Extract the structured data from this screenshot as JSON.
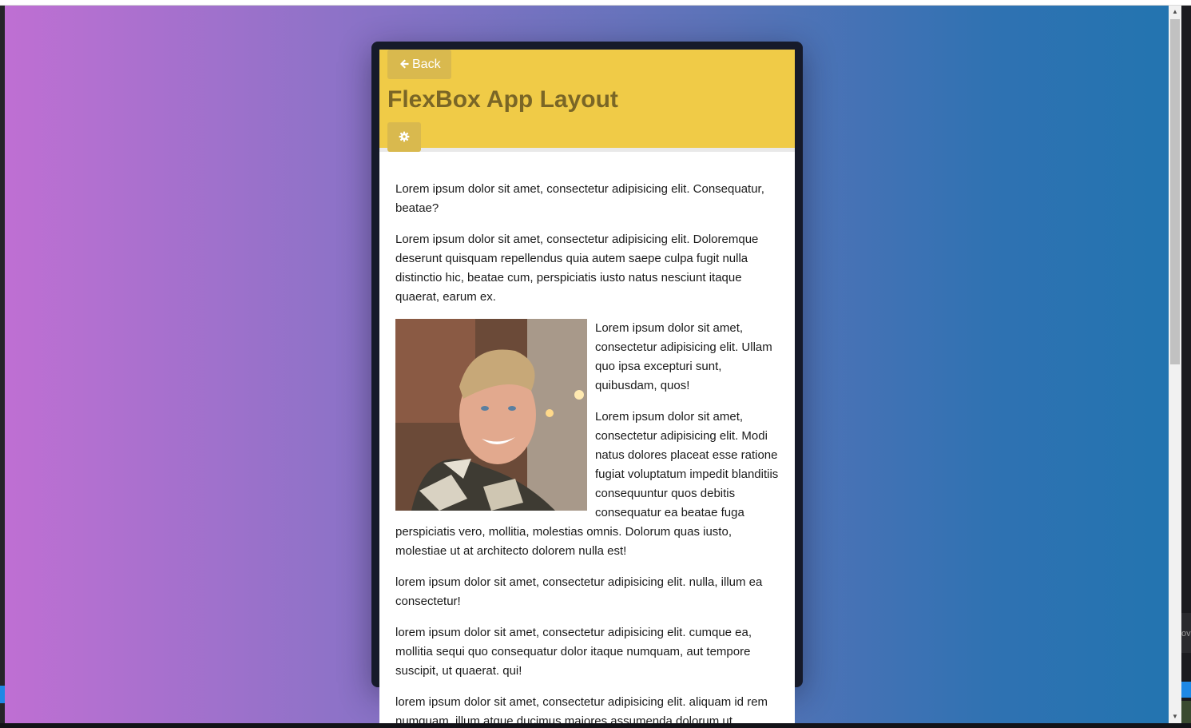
{
  "app": {
    "back_label": "Back",
    "title": "FlexBox App Layout"
  },
  "icons": {
    "back": "arrow-left-icon",
    "settings": "gear-icon"
  },
  "colors": {
    "header": "#f0cb47",
    "header_button": "#d9b94e",
    "title_text": "#7a6626",
    "phone_frame": "#161a2a"
  },
  "content": {
    "paragraphs": [
      "Lorem ipsum dolor sit amet, consectetur adipisicing elit. Consequatur, beatae?",
      "Lorem ipsum dolor sit amet, consectetur adipisicing elit. Doloremque deserunt quisquam repellendus quia autem saepe culpa fugit nulla distinctio hic, beatae cum, perspiciatis iusto natus nesciunt itaque quaerat, earum ex.",
      "Lorem ipsum dolor sit amet, consectetur adipisicing elit. Ullam quo ipsa excepturi sunt, quibusdam, quos!",
      "Lorem ipsum dolor sit amet, consectetur adipisicing elit. Modi natus dolores placeat esse ratione fugiat voluptatum impedit blanditiis consequuntur quos debitis consequatur ea beatae fuga perspiciatis vero, mollitia, molestias omnis. Dolorum quas iusto, molestiae ut at architecto dolorem nulla est!",
      "lorem ipsum dolor sit amet, consectetur adipisicing elit. nulla, illum ea consectetur!",
      "lorem ipsum dolor sit amet, consectetur adipisicing elit. cumque ea, mollitia sequi quo consequatur dolor itaque numquam, aut tempore suscipit, ut quaerat. qui!",
      "lorem ipsum dolor sit amet, consectetur adipisicing elit. aliquam id rem numquam, illum atque ducimus maiores assumenda dolorum ut"
    ]
  },
  "right_panel_text": "ov"
}
